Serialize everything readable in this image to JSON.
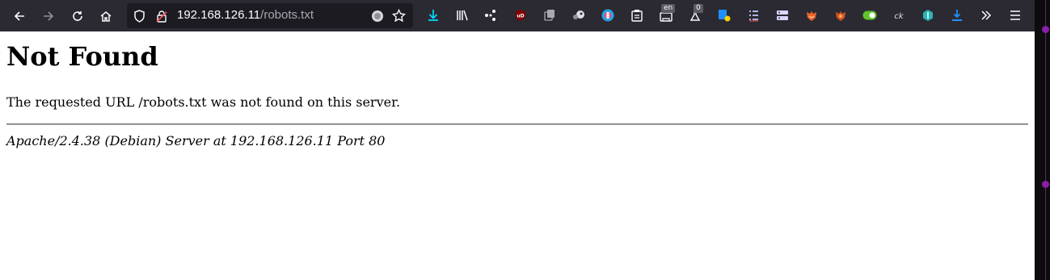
{
  "browser": {
    "url_host": "192.168.126.11",
    "url_path": "/robots.txt",
    "extension_badges": {
      "translate": "en",
      "counter": "0"
    }
  },
  "page": {
    "heading": "Not Found",
    "message": "The requested URL /robots.txt was not found on this server.",
    "server_signature": "Apache/2.4.38 (Debian) Server at 192.168.126.11 Port 80"
  },
  "colors": {
    "toolbar_bg": "#2b2a33",
    "urlbar_bg": "#1c1b22",
    "download_accent": "#00ddff",
    "page_bg": "#ffffff"
  },
  "icons": [
    "back-icon",
    "forward-icon",
    "reload-icon",
    "home-icon",
    "shield-icon",
    "lock-warning-icon",
    "reader-mode-icon",
    "bookmark-star-icon",
    "downloads-icon",
    "library-icon",
    "extensions-icon",
    "ublock-icon",
    "menu-icon",
    "overflow-icon"
  ]
}
